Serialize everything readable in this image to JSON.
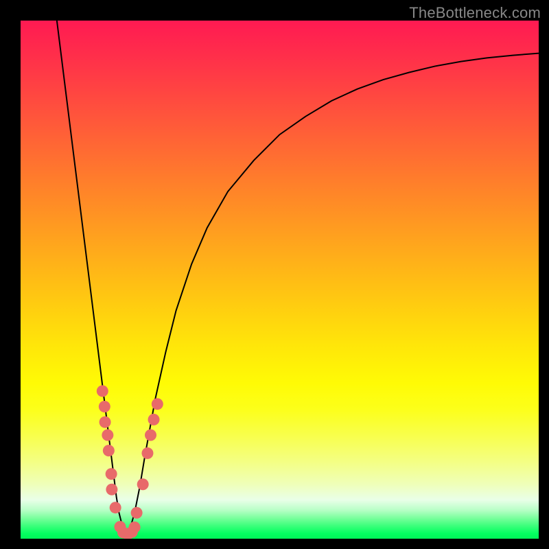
{
  "watermark": "TheBottleneck.com",
  "chart_data": {
    "type": "line",
    "title": "",
    "xlabel": "",
    "ylabel": "",
    "xlim": [
      0,
      100
    ],
    "ylim": [
      0,
      100
    ],
    "series": [
      {
        "name": "left-branch",
        "x": [
          7,
          8,
          9,
          10,
          11,
          12,
          13,
          14,
          15,
          16,
          17,
          18,
          18.5,
          19,
          19.5,
          20,
          20.3
        ],
        "y": [
          100,
          92,
          84,
          76,
          68,
          60,
          52,
          44,
          36,
          28,
          20,
          12,
          8,
          5,
          3,
          1.2,
          0.5
        ]
      },
      {
        "name": "right-branch",
        "x": [
          20.3,
          21,
          22,
          23,
          24,
          26,
          28,
          30,
          33,
          36,
          40,
          45,
          50,
          55,
          60,
          65,
          70,
          75,
          80,
          85,
          90,
          95,
          100
        ],
        "y": [
          0.5,
          1.5,
          5,
          10,
          16,
          27,
          36,
          44,
          53,
          60,
          67,
          73,
          78,
          81.5,
          84.5,
          86.8,
          88.6,
          90,
          91.2,
          92.1,
          92.8,
          93.3,
          93.7
        ]
      }
    ],
    "scatter": [
      {
        "name": "marker-cluster",
        "color": "#e86a6a",
        "points": [
          {
            "x": 15.8,
            "y": 28.5
          },
          {
            "x": 16.2,
            "y": 25.5
          },
          {
            "x": 16.3,
            "y": 22.5
          },
          {
            "x": 16.8,
            "y": 20.0
          },
          {
            "x": 17.0,
            "y": 17.0
          },
          {
            "x": 17.5,
            "y": 12.5
          },
          {
            "x": 17.6,
            "y": 9.5
          },
          {
            "x": 18.3,
            "y": 6.0
          },
          {
            "x": 19.2,
            "y": 2.3
          },
          {
            "x": 19.8,
            "y": 1.2
          },
          {
            "x": 20.7,
            "y": 0.9
          },
          {
            "x": 21.5,
            "y": 1.3
          },
          {
            "x": 22.0,
            "y": 2.2
          },
          {
            "x": 22.4,
            "y": 5.0
          },
          {
            "x": 23.6,
            "y": 10.5
          },
          {
            "x": 24.5,
            "y": 16.5
          },
          {
            "x": 25.1,
            "y": 20.0
          },
          {
            "x": 25.7,
            "y": 23.0
          },
          {
            "x": 26.4,
            "y": 26.0
          }
        ]
      }
    ]
  }
}
